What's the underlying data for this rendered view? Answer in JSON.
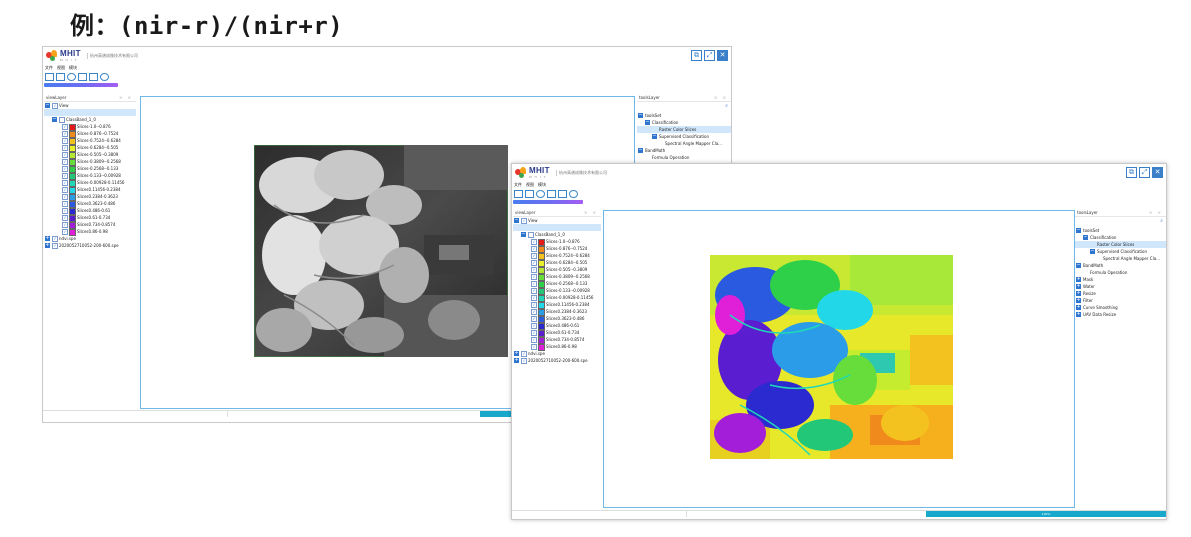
{
  "heading": "例：(nir-r)/(nir+r)",
  "app": {
    "brand": "MHIT",
    "brand_sub": "M H I T",
    "company": "杭州高谱成像技术有限公司",
    "window_buttons": [
      "restore-icon",
      "maximize-icon",
      "close-icon"
    ],
    "menu": [
      "文件",
      "视图",
      "模块"
    ],
    "toolbar_icons": [
      "open-folder-icon",
      "file-icon",
      "home-icon",
      "chart-icon",
      "image-icon",
      "export-icon"
    ]
  },
  "viewlayer": {
    "title": "viewLayer",
    "title_controls": "× ×",
    "view_label": "View",
    "classband_label": "ClassBand_1_0",
    "slices": [
      {
        "label": "Slices-1.0--0.876",
        "color": "#e41a1a"
      },
      {
        "label": "Slices-0.876--0.7524",
        "color": "#f08a1c"
      },
      {
        "label": "Slices-0.7524--0.6284",
        "color": "#f4c21e"
      },
      {
        "label": "Slices-0.6284--0.505",
        "color": "#e8f02a"
      },
      {
        "label": "Slices-0.505--0.3809",
        "color": "#b4e832"
      },
      {
        "label": "Slices-0.3809--0.2568",
        "color": "#66dd3a"
      },
      {
        "label": "Slices-0.2568--0.133",
        "color": "#2ed04a"
      },
      {
        "label": "Slices-0.133--0.00928",
        "color": "#22c878"
      },
      {
        "label": "Slices-0.00928-0.11456",
        "color": "#20d8b8"
      },
      {
        "label": "Slices0.11456-0.2384",
        "color": "#22d8e8"
      },
      {
        "label": "Slices0.2384-0.3623",
        "color": "#2a9ce8"
      },
      {
        "label": "Slices0.3623-0.486",
        "color": "#2a5ae0"
      },
      {
        "label": "Slices0.486-0.61",
        "color": "#2a2ad0"
      },
      {
        "label": "Slices0.61-0.734",
        "color": "#5a1ed0"
      },
      {
        "label": "Slices0.734-0.8574",
        "color": "#a21ed8"
      },
      {
        "label": "Slices0.86-0.98",
        "color": "#e020d8"
      }
    ],
    "file1": "ndvi.spe",
    "file2": "2020052710052-200-600.spe"
  },
  "toolslayer": {
    "title": "toolsLayer",
    "title_controls": "× ×",
    "toolset": "toolsSet",
    "classification": "Classification",
    "raster_color_slices": "Raster Color Slices",
    "supervised": "Supervised Classification",
    "spectral_angle": "Spectral Angle Mapper Cla...",
    "bandmath": "BandMath",
    "formula": "Formula Operation",
    "mask": "Mask",
    "water": "Water",
    "resize": "Resize",
    "filter": "Filter",
    "curve_smoothing": "Curve Smoothing",
    "uav_resize": "UAV Data Resize"
  },
  "status": {
    "progress_label": "100%",
    "progress": 1.0
  }
}
